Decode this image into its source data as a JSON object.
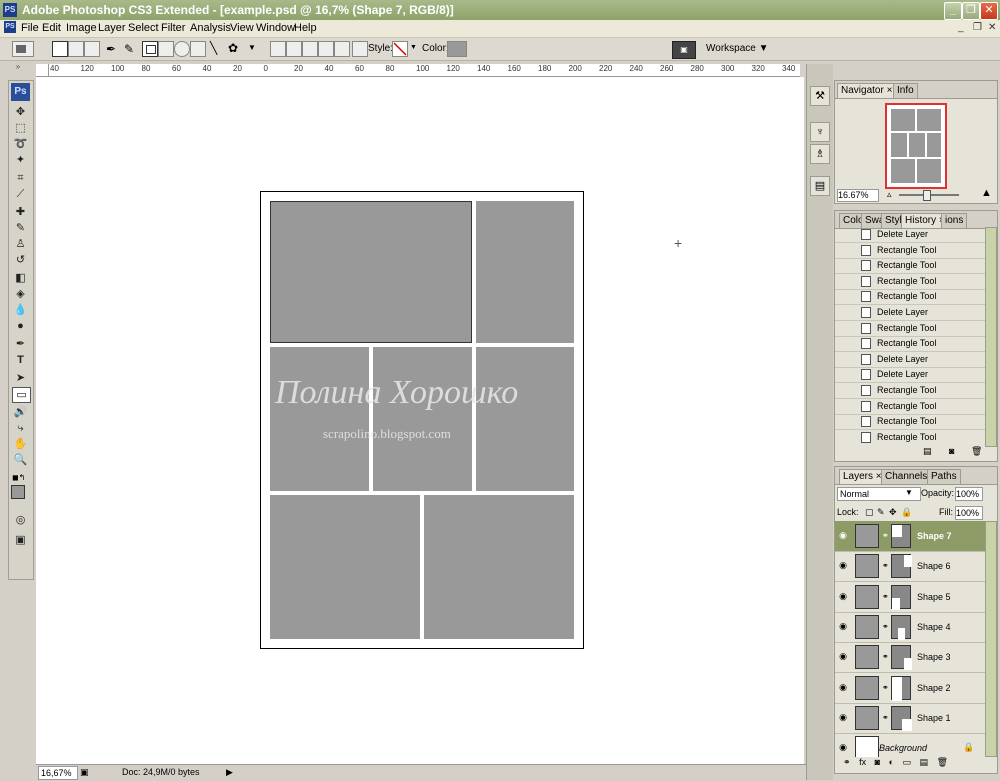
{
  "window": {
    "app_icon": "PS",
    "title": "Adobe Photoshop CS3 Extended - [example.psd @ 16,7% (Shape 7, RGB/8)]",
    "buttons": [
      "_",
      "❐",
      "✕"
    ]
  },
  "menu": {
    "items": [
      "File",
      "Edit",
      "Image",
      "Layer",
      "Select",
      "Filter",
      "Analysis",
      "View",
      "Window",
      "Help"
    ],
    "mdi_buttons": [
      "_",
      "❐",
      "✕"
    ]
  },
  "options_bar": {
    "style_label": "Style:",
    "color_label": "Color:",
    "color_value": "#999999",
    "workspace_label": "Workspace ▼"
  },
  "ruler": {
    "h_ticks": [
      "40",
      "120",
      "100",
      "80",
      "60",
      "40",
      "20",
      "0",
      "20",
      "40",
      "60",
      "80",
      "100",
      "120",
      "140",
      "160",
      "180",
      "200",
      "220",
      "240",
      "260",
      "280",
      "300",
      "320",
      "340"
    ]
  },
  "canvas": {
    "watermark_script": "Полина Хорошко",
    "watermark_url": "scrapolino.blogspot.com",
    "cell_color": "#999999"
  },
  "status": {
    "zoom": "16,67%",
    "doc": "Doc: 24,9M/0 bytes"
  },
  "navigator": {
    "tabs": [
      "Navigator",
      "Info"
    ],
    "zoom": "16.67%"
  },
  "history": {
    "tabs": [
      "Colo",
      "Swa",
      "Styl",
      "History",
      "ions"
    ],
    "items": [
      {
        "label": "Delete Layer"
      },
      {
        "label": "Rectangle Tool"
      },
      {
        "label": "Rectangle Tool"
      },
      {
        "label": "Rectangle Tool"
      },
      {
        "label": "Rectangle Tool"
      },
      {
        "label": "Delete Layer"
      },
      {
        "label": "Rectangle Tool"
      },
      {
        "label": "Rectangle Tool"
      },
      {
        "label": "Delete Layer"
      },
      {
        "label": "Delete Layer"
      },
      {
        "label": "Rectangle Tool"
      },
      {
        "label": "Rectangle Tool"
      },
      {
        "label": "Rectangle Tool"
      },
      {
        "label": "Rectangle Tool"
      }
    ]
  },
  "layers": {
    "tabs": [
      "Layers",
      "Channels",
      "Paths"
    ],
    "blend_mode": "Normal",
    "opacity_label": "Opacity:",
    "opacity": "100%",
    "lock_label": "Lock:",
    "fill_label": "Fill:",
    "fill": "100%",
    "items": [
      {
        "name": "Shape 7",
        "selected": true
      },
      {
        "name": "Shape 6"
      },
      {
        "name": "Shape 5"
      },
      {
        "name": "Shape 4"
      },
      {
        "name": "Shape 3"
      },
      {
        "name": "Shape 2"
      },
      {
        "name": "Shape 1"
      },
      {
        "name": "Background",
        "italic": true
      }
    ]
  }
}
